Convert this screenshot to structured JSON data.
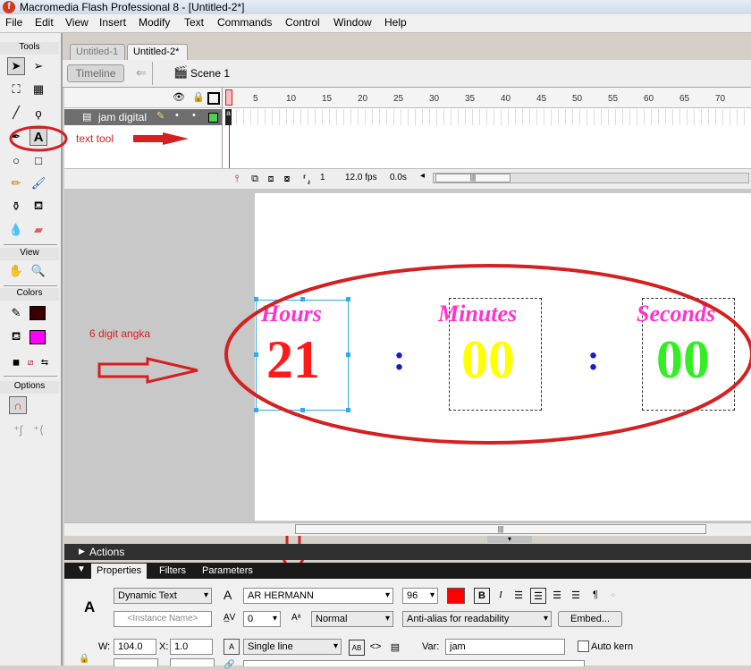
{
  "window": {
    "title": "Macromedia Flash Professional 8 - [Untitled-2*]",
    "app_icon": "flash-icon"
  },
  "menu": [
    "File",
    "Edit",
    "View",
    "Insert",
    "Modify",
    "Text",
    "Commands",
    "Control",
    "Window",
    "Help"
  ],
  "tools_panel": {
    "title": "Tools",
    "view_label": "View",
    "colors_label": "Colors",
    "options_label": "Options",
    "stroke_color": "#3a0000",
    "fill_color": "#ff00ff"
  },
  "doc_tabs": [
    "Untitled-1",
    "Untitled-2*"
  ],
  "timeline": {
    "toggle_label": "Timeline",
    "scene_label": "Scene 1",
    "layer_name": "jam digital",
    "ruler_ticks": [
      "1",
      "5",
      "10",
      "15",
      "20",
      "25",
      "30",
      "35",
      "40",
      "45",
      "50",
      "55",
      "60",
      "65",
      "70"
    ],
    "current_frame": "1",
    "fps": "12.0 fps",
    "elapsed": "0.0s"
  },
  "annotations": {
    "text_tool_label": "text tool",
    "digits_label": "6 digit angka",
    "text_label": "text",
    "annotation_color": "#d42020"
  },
  "stage": {
    "hours_label": "Hours",
    "minutes_label": "Minutes",
    "seconds_label": "Seconds",
    "hours_value": "21",
    "minutes_value": "00",
    "seconds_value": "00",
    "separator": ":",
    "label_color": "#ff33cc",
    "hours_color": "#ff1a1a",
    "minutes_color": "#ffff00",
    "seconds_color": "#33ee22",
    "separator_color": "#1a1acc"
  },
  "panels": {
    "actions_label": "Actions",
    "tabs": [
      "Properties",
      "Filters",
      "Parameters"
    ]
  },
  "properties": {
    "text_type": "Dynamic Text",
    "instance_placeholder": "<Instance Name>",
    "font": "AR HERMANN",
    "font_size": "96",
    "text_color": "#ff0000",
    "letter_spacing": "0",
    "position_mode": "Normal",
    "antialias": "Anti-alias for readability",
    "embed_label": "Embed...",
    "w_label": "W:",
    "w_value": "104.0",
    "x_label": "X:",
    "x_value": "1.0",
    "line_type": "Single line",
    "var_label": "Var:",
    "var_value": "jam",
    "auto_kern_label": "Auto kern"
  }
}
